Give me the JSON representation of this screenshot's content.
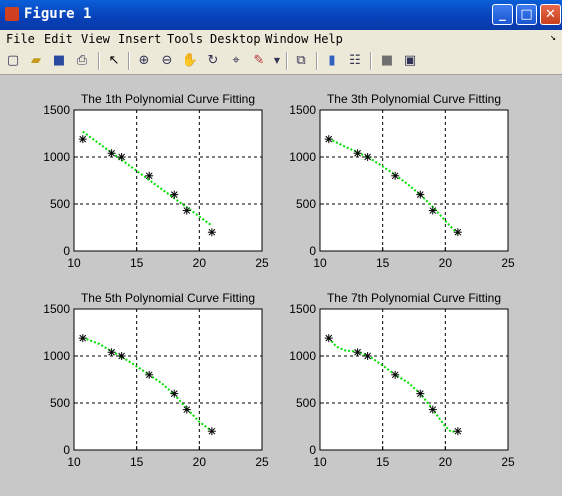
{
  "window": {
    "title": "Figure 1",
    "minimize": "_",
    "maximize": "□",
    "close": "✕"
  },
  "menu": [
    "File",
    "Edit",
    "View",
    "Insert",
    "Tools",
    "Desktop",
    "Window",
    "Help"
  ],
  "toolbar_icons": [
    "new-figure-icon",
    "open-file-icon",
    "save-icon",
    "print-icon",
    "pointer-icon",
    "zoom-in-icon",
    "zoom-out-icon",
    "pan-icon",
    "rotate-3d-icon",
    "data-cursor-icon",
    "brush-icon",
    "link-plot-icon",
    "colorbar-icon",
    "legend-icon",
    "hide-plot-tools-icon",
    "show-plot-tools-icon"
  ],
  "chart_data": [
    {
      "type": "line",
      "title": "The 1th Polynomial Curve Fitting",
      "xlim": [
        10,
        25
      ],
      "ylim": [
        0,
        1500
      ],
      "xticks": [
        10,
        15,
        20,
        25
      ],
      "yticks": [
        0,
        500,
        1000,
        1500
      ],
      "grid": true,
      "points": {
        "x": [
          10.7,
          13,
          13.8,
          16,
          18,
          19,
          21
        ],
        "y": [
          1190,
          1040,
          1000,
          800,
          600,
          430,
          200
        ]
      },
      "fit": {
        "x": [
          10.7,
          21
        ],
        "y": [
          1270,
          270
        ]
      },
      "colors": {
        "points": "#000000",
        "fit": "#00e000"
      }
    },
    {
      "type": "line",
      "title": "The 3th Polynomial Curve Fitting",
      "xlim": [
        10,
        25
      ],
      "ylim": [
        0,
        1500
      ],
      "xticks": [
        10,
        15,
        20,
        25
      ],
      "yticks": [
        0,
        500,
        1000,
        1500
      ],
      "grid": true,
      "points": {
        "x": [
          10.7,
          13,
          13.8,
          16,
          18,
          19,
          21
        ],
        "y": [
          1190,
          1040,
          1000,
          800,
          600,
          430,
          200
        ]
      },
      "fit": {
        "x": [
          10.7,
          12,
          13,
          14,
          15,
          16,
          17,
          18,
          19,
          20,
          21
        ],
        "y": [
          1195,
          1110,
          1050,
          985,
          900,
          810,
          710,
          600,
          470,
          320,
          180
        ]
      },
      "colors": {
        "points": "#000000",
        "fit": "#00e000"
      }
    },
    {
      "type": "line",
      "title": "The 5th Polynomial Curve Fitting",
      "xlim": [
        10,
        25
      ],
      "ylim": [
        0,
        1500
      ],
      "xticks": [
        10,
        15,
        20,
        25
      ],
      "yticks": [
        0,
        500,
        1000,
        1500
      ],
      "grid": true,
      "points": {
        "x": [
          10.7,
          13,
          13.8,
          16,
          18,
          19,
          21
        ],
        "y": [
          1190,
          1040,
          1000,
          800,
          600,
          430,
          200
        ]
      },
      "fit": {
        "x": [
          10.7,
          12,
          13,
          14,
          15,
          16,
          17,
          18,
          19,
          20,
          21
        ],
        "y": [
          1195,
          1130,
          1050,
          975,
          890,
          800,
          710,
          590,
          440,
          300,
          200
        ]
      },
      "colors": {
        "points": "#000000",
        "fit": "#00e000"
      }
    },
    {
      "type": "line",
      "title": "The 7th Polynomial Curve Fitting",
      "xlim": [
        10,
        25
      ],
      "ylim": [
        0,
        1500
      ],
      "xticks": [
        10,
        15,
        20,
        25
      ],
      "yticks": [
        0,
        500,
        1000,
        1500
      ],
      "grid": true,
      "points": {
        "x": [
          10.7,
          13,
          13.8,
          16,
          18,
          19,
          21
        ],
        "y": [
          1190,
          1040,
          1000,
          800,
          600,
          430,
          200
        ]
      },
      "fit": {
        "x": [
          10.7,
          11.3,
          12,
          13,
          14,
          15,
          16,
          17,
          18,
          19,
          20,
          20.5,
          21
        ],
        "y": [
          1190,
          1100,
          1060,
          1045,
          990,
          900,
          800,
          720,
          600,
          430,
          250,
          190,
          210
        ]
      },
      "colors": {
        "points": "#000000",
        "fit": "#00e000"
      }
    }
  ]
}
